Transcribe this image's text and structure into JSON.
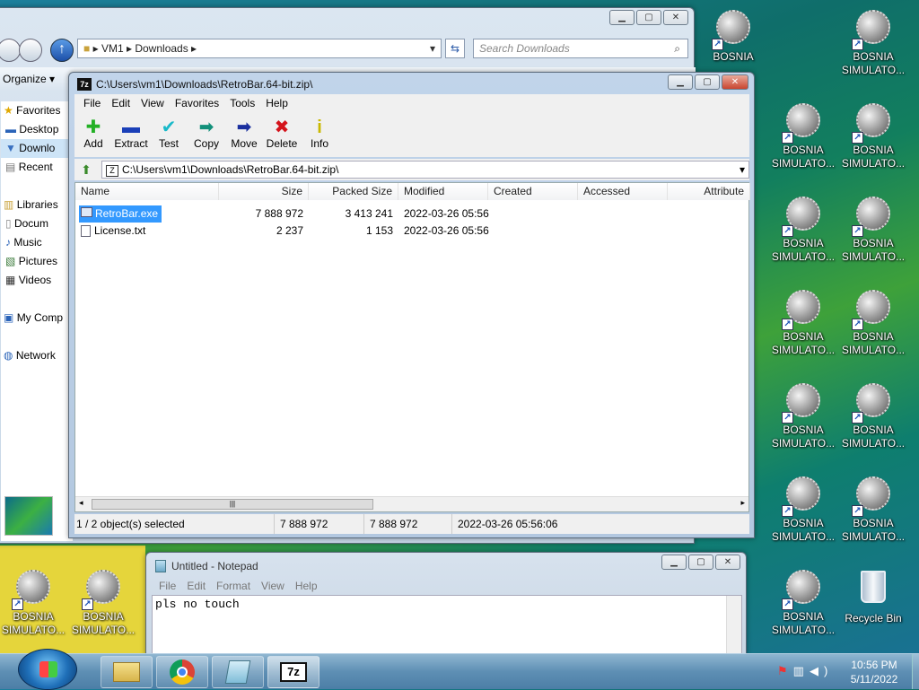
{
  "explorer": {
    "breadcrumb": [
      "VM1",
      "Downloads"
    ],
    "search_placeholder": "Search Downloads",
    "organize": "Organize",
    "nav": [
      "Favorites",
      "Desktop",
      "Downlo",
      "Recent",
      "Libraries",
      "Docum",
      "Music",
      "Pictures",
      "Videos",
      "My Comp",
      "Network"
    ]
  },
  "sevenzip": {
    "title": "C:\\Users\\vm1\\Downloads\\RetroBar.64-bit.zip\\",
    "menu": [
      "File",
      "Edit",
      "View",
      "Favorites",
      "Tools",
      "Help"
    ],
    "tools": [
      {
        "label": "Add",
        "icon": "add-icon",
        "color": "#23b025"
      },
      {
        "label": "Extract",
        "icon": "extract-icon",
        "color": "#1a3fb8"
      },
      {
        "label": "Test",
        "icon": "test-icon",
        "color": "#19b9c9"
      },
      {
        "label": "Copy",
        "icon": "copy-icon",
        "color": "#12907a"
      },
      {
        "label": "Move",
        "icon": "move-icon",
        "color": "#1a2f9e"
      },
      {
        "label": "Delete",
        "icon": "delete-icon",
        "color": "#d4131b"
      },
      {
        "label": "Info",
        "icon": "info-icon",
        "color": "#c9b800"
      }
    ],
    "address": "C:\\Users\\vm1\\Downloads\\RetroBar.64-bit.zip\\",
    "columns": [
      "Name",
      "Size",
      "Packed Size",
      "Modified",
      "Created",
      "Accessed",
      "Attribute"
    ],
    "files": [
      {
        "name": "RetroBar.exe",
        "size": "7 888 972",
        "packed": "3 413 241",
        "modified": "2022-03-26 05:56"
      },
      {
        "name": "License.txt",
        "size": "2 237",
        "packed": "1 153",
        "modified": "2022-03-26 05:56"
      }
    ],
    "status": [
      "1 / 2 object(s) selected",
      "7 888 972",
      "7 888 972",
      "2022-03-26 05:56:06"
    ]
  },
  "notepad": {
    "title": "Untitled - Notepad",
    "menu": [
      "File",
      "Edit",
      "Format",
      "View",
      "Help"
    ],
    "text": "pls no touch"
  },
  "desktop": {
    "icon_line1": "BOSNIA",
    "icon_line2": "SIMULATO...",
    "recycle": "Recycle Bin"
  },
  "clock": {
    "time": "10:56 PM",
    "date": "5/11/2022"
  }
}
